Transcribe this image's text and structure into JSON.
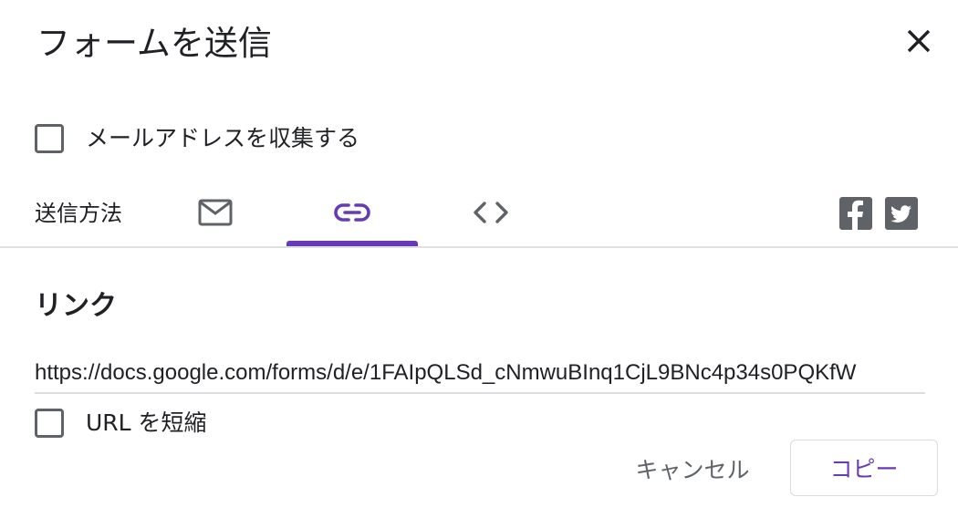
{
  "dialog": {
    "title": "フォームを送信",
    "close_icon": "close-icon"
  },
  "collect_email": {
    "label": "メールアドレスを収集する",
    "checked": false
  },
  "send_via": {
    "label": "送信方法",
    "tabs": [
      {
        "icon": "email-icon",
        "selected": false
      },
      {
        "icon": "link-icon",
        "selected": true
      },
      {
        "icon": "embed-code-icon",
        "selected": false
      }
    ],
    "social": [
      {
        "icon": "facebook-icon"
      },
      {
        "icon": "twitter-icon"
      }
    ],
    "accent_color": "#673ab7"
  },
  "link_section": {
    "title": "リンク",
    "url_value": "https://docs.google.com/forms/d/e/1FAIpQLSd_cNmwuBInq1CjL9BNc4p34s0PQKfW",
    "shorten_url_label": "URL を短縮",
    "shorten_checked": false
  },
  "actions": {
    "cancel_label": "キャンセル",
    "copy_label": "コピー"
  }
}
